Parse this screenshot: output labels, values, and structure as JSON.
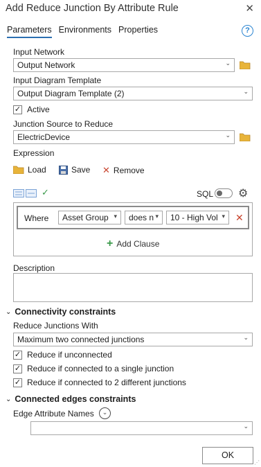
{
  "window": {
    "title": "Add Reduce Junction By Attribute Rule",
    "close": "✕"
  },
  "tabs": [
    "Parameters",
    "Environments",
    "Properties"
  ],
  "help": "?",
  "params": {
    "input_network_label": "Input Network",
    "input_network_value": "Output Network",
    "template_label": "Input Diagram Template",
    "template_value": "Output Diagram Template (2)",
    "active_label": "Active",
    "active_checked": true,
    "junction_source_label": "Junction Source to Reduce",
    "junction_source_value": "ElectricDevice",
    "expression_label": "Expression"
  },
  "expression": {
    "load": "Load",
    "save": "Save",
    "remove": "Remove",
    "sql_label": "SQL",
    "where_label": "Where",
    "field": "Asset Group",
    "operator": "does n",
    "value": "10 - High Vol",
    "add_clause": "Add Clause"
  },
  "description_label": "Description",
  "connectivity": {
    "section_title": "Connectivity constraints",
    "reduce_with_label": "Reduce Junctions With",
    "reduce_with_value": "Maximum two connected junctions",
    "options": [
      {
        "label": "Reduce if unconnected",
        "checked": true
      },
      {
        "label": "Reduce if connected to a single junction",
        "checked": true
      },
      {
        "label": "Reduce if connected to 2 different junctions",
        "checked": true
      }
    ]
  },
  "edges": {
    "section_title": "Connected edges constraints",
    "attr_names_label": "Edge Attribute Names",
    "attr_names_value": ""
  },
  "ok": "OK",
  "colors": {
    "accent": "#2a6fb1",
    "folder": "#e8b43a",
    "remove_red": "#c9452f",
    "add_green": "#3a9a4a"
  }
}
